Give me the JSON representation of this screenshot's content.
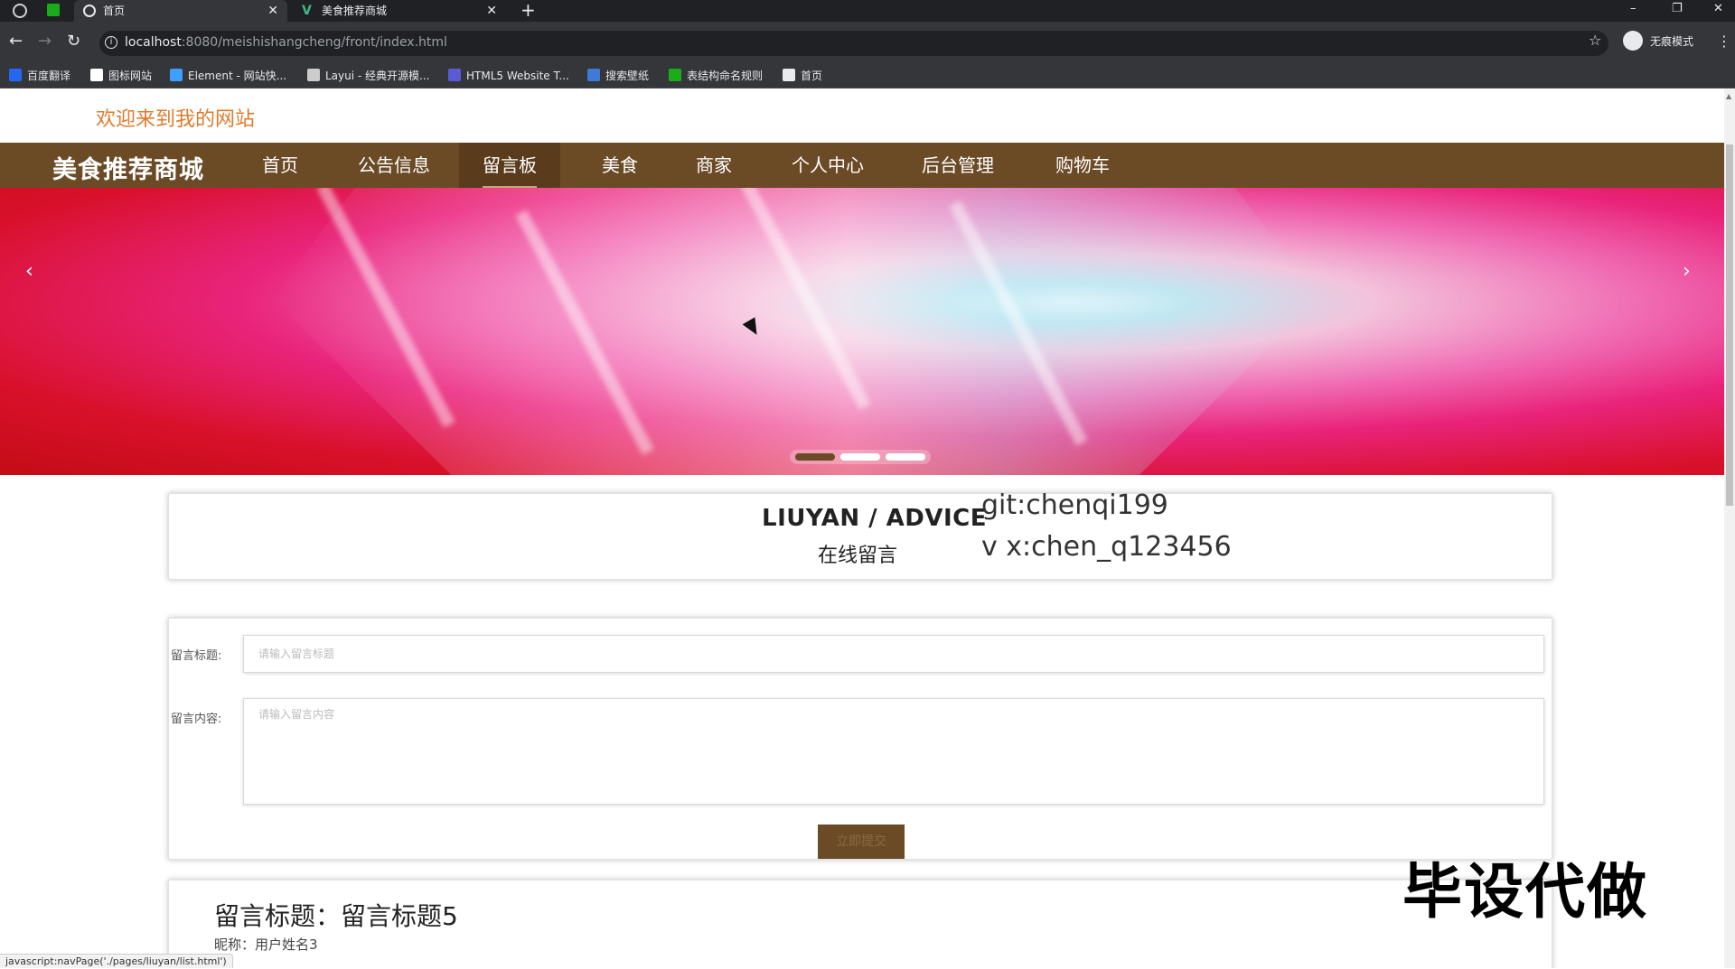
{
  "browser": {
    "tabs": [
      {
        "title": "首页",
        "active": true
      },
      {
        "title": "美食推荐商城",
        "active": false
      }
    ],
    "new_tab": "+",
    "window_controls": {
      "minimize": "–",
      "restore": "❐",
      "close": "✕"
    },
    "nav": {
      "back": "←",
      "forward": "→",
      "reload": "↻"
    },
    "url_host": "localhost",
    "url_rest": ":8080/meishishangcheng/front/index.html",
    "star": "☆",
    "incognito_label": "无痕模式",
    "menu": "⋮",
    "bookmarks": [
      {
        "label": "百度翻译",
        "icon_color": "#2468f2"
      },
      {
        "label": "图标网站",
        "icon_color": "#ffffff"
      },
      {
        "label": "Element - 网站快...",
        "icon_color": "#409eff"
      },
      {
        "label": "Layui - 经典开源模...",
        "icon_color": "#cccccc"
      },
      {
        "label": "HTML5 Website T...",
        "icon_color": "#5b5bd6"
      },
      {
        "label": "搜索壁纸",
        "icon_color": "#3d7bd6"
      },
      {
        "label": "表结构命名规则",
        "icon_color": "#1aad19"
      },
      {
        "label": "首页",
        "icon_color": "#e8eaed"
      }
    ]
  },
  "site": {
    "welcome": "欢迎来到我的网站",
    "brand": "美食推荐商城",
    "nav": [
      "首页",
      "公告信息",
      "留言板",
      "美食",
      "商家",
      "个人中心",
      "后台管理",
      "购物车"
    ],
    "active_nav_index": 2,
    "banner": {
      "prev": "‹",
      "next": "›",
      "slide_count": 3,
      "current_slide": 1
    },
    "header": {
      "title_en": "LIUYAN / ADVICE",
      "title_cn": "在线留言"
    },
    "contact": {
      "git": "git:chenqi199",
      "vx": "v x:chen_q123456"
    },
    "form": {
      "title_label": "留言标题:",
      "title_placeholder": "请输入留言标题",
      "content_label": "留言内容:",
      "content_placeholder": "请输入留言内容",
      "submit_label": "立即提交"
    },
    "message": {
      "title": "留言标题：留言标题5",
      "nick": "昵称：用户姓名3"
    },
    "watermark": "毕设代做",
    "status_url": "javascript:navPage('./pages/liuyan/list.html')"
  },
  "colors": {
    "nav_bg": "#6b4a26",
    "welcome_text": "#e07b2c"
  }
}
